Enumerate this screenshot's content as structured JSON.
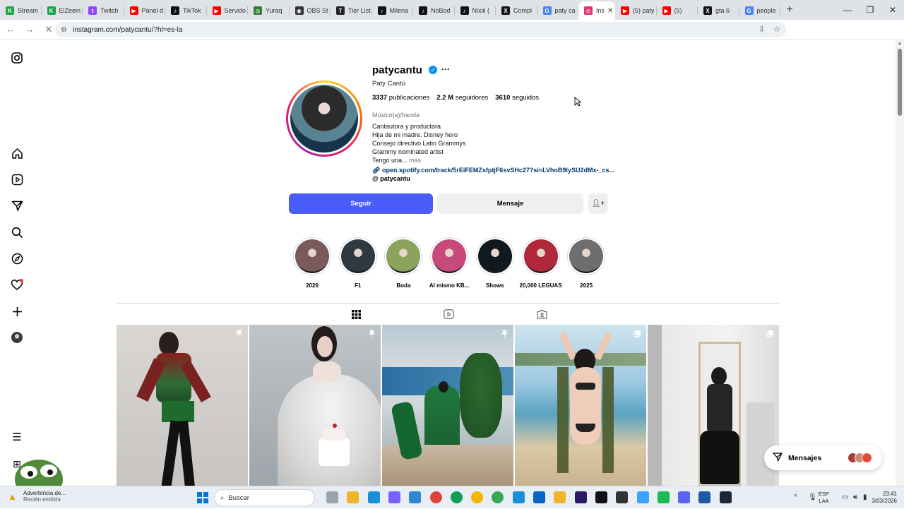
{
  "browser": {
    "tabs": [
      {
        "title": "Stream",
        "color": "#1ea445",
        "glyph": "K"
      },
      {
        "title": "ElZeein",
        "color": "#1ea445",
        "glyph": "K"
      },
      {
        "title": "Twitch",
        "color": "#9146ff",
        "glyph": "t"
      },
      {
        "title": "Panel d",
        "color": "#ff0000",
        "glyph": "▶"
      },
      {
        "title": "TikTok",
        "color": "#111111",
        "glyph": "♪"
      },
      {
        "title": "Servido",
        "color": "#ff0000",
        "glyph": "▶"
      },
      {
        "title": "Yuraq",
        "color": "#2e7d32",
        "glyph": "◎"
      },
      {
        "title": "OBS St",
        "color": "#333333",
        "glyph": "◉"
      },
      {
        "title": "Tier List",
        "color": "#222222",
        "glyph": "T"
      },
      {
        "title": "Milena",
        "color": "#111111",
        "glyph": "♪"
      },
      {
        "title": "NoBod",
        "color": "#111111",
        "glyph": "♪"
      },
      {
        "title": "Nixiii (",
        "color": "#111111",
        "glyph": "♪"
      },
      {
        "title": "Compl",
        "color": "#111111",
        "glyph": "X"
      },
      {
        "title": "paty ca",
        "color": "#4285f4",
        "glyph": "G"
      },
      {
        "title": "Ins",
        "color": "#e1306c",
        "glyph": "◎",
        "active": true
      },
      {
        "title": "(5) paty",
        "color": "#ff0000",
        "glyph": "▶"
      },
      {
        "title": "(5)",
        "color": "#ff0000",
        "glyph": "▶"
      },
      {
        "title": "gta 6",
        "color": "#111111",
        "glyph": "X"
      },
      {
        "title": "people",
        "color": "#4285f4",
        "glyph": "G"
      }
    ],
    "url": "instagram.com/patycantu/?hl=es-la"
  },
  "profile": {
    "username": "patycantu",
    "full_name": "Paty Cantú",
    "posts_count": "3337",
    "posts_label": "publicaciones",
    "followers_count": "2.2 M",
    "followers_label": "seguidores",
    "following_count": "3610",
    "following_label": "seguidos",
    "category": "Músico(a)/banda",
    "bio_lines": [
      "Cantautora y productora",
      "Hija de mi madre. Disney hero",
      "Consejo directivo Latin Grammys",
      "Grammy nominated artist",
      "Tengo una..."
    ],
    "bio_more": "más",
    "link": "open.spotify.com/track/5rEiFEMZsfptjF6svSHc27?si=LVhoB9IySU2dMx-_cs...",
    "threads": "patycantu",
    "follow_label": "Seguir",
    "message_label": "Mensaje"
  },
  "highlights": [
    {
      "label": "2026",
      "color": "#7a5a5a"
    },
    {
      "label": "F1",
      "color": "#2f3a40"
    },
    {
      "label": "Boda",
      "color": "#8ba35c"
    },
    {
      "label": "Al mismo KB...",
      "color": "#c74a7a"
    },
    {
      "label": "Shows",
      "color": "#101820"
    },
    {
      "label": "20,000 LEGUAS",
      "color": "#b0283a"
    },
    {
      "label": "2025",
      "color": "#6e6e6e"
    }
  ],
  "messages_label": "Mensajes",
  "taskbar": {
    "warning_title": "Advertencia de...",
    "warning_sub": "Recién emitida",
    "search_placeholder": "Buscar",
    "lang_line1": "ESP",
    "lang_line2": "LAA",
    "time": "23:41",
    "date": "3/03/2026"
  }
}
